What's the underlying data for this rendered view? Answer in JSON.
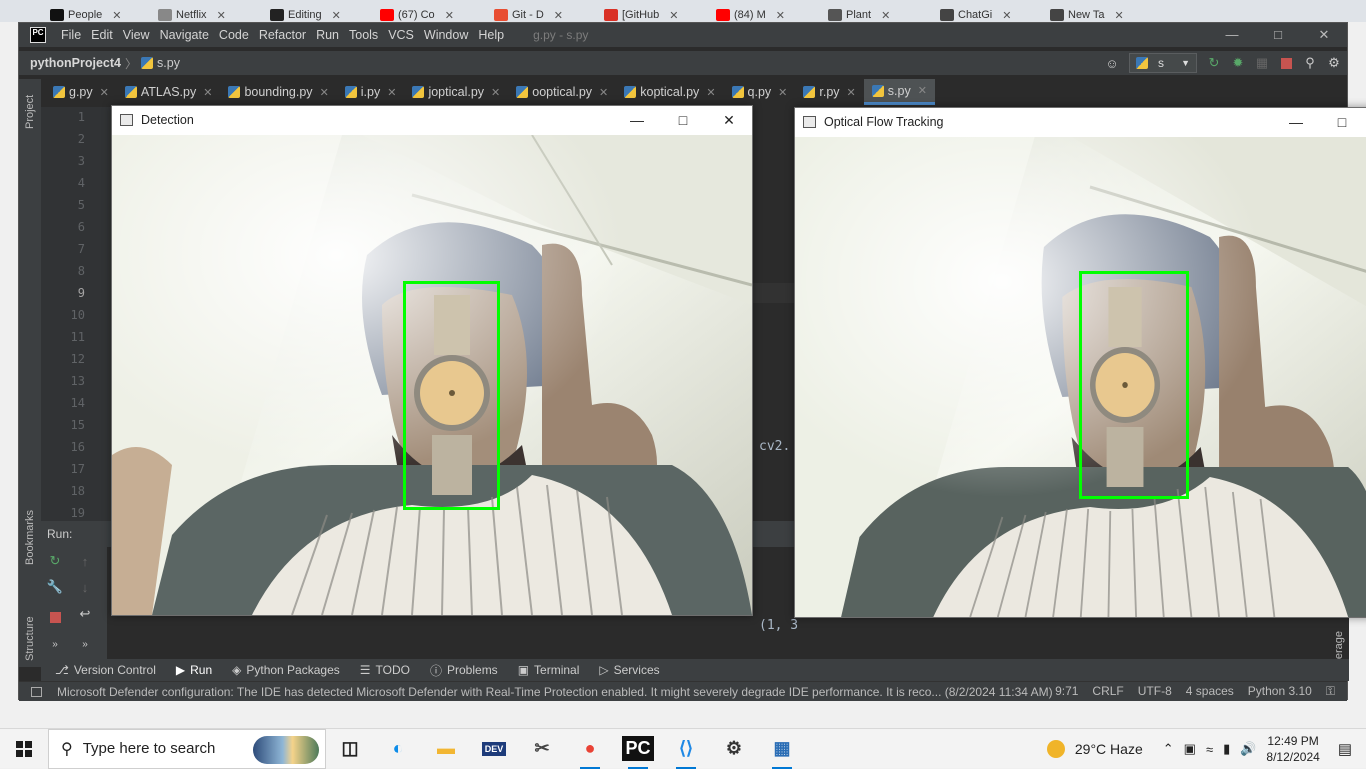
{
  "browser_tabs": [
    {
      "label": "People",
      "color": "#111111"
    },
    {
      "label": "Netflix",
      "color": "#888888"
    },
    {
      "label": "Editing",
      "color": "#222222"
    },
    {
      "label": "(67) Co",
      "color": "#ff0000"
    },
    {
      "label": "Git - D",
      "color": "#e84d31"
    },
    {
      "label": "[GitHub",
      "color": "#d93025"
    },
    {
      "label": "(84) M",
      "color": "#ff0000"
    },
    {
      "label": "Plant",
      "color": "#555555"
    },
    {
      "label": "ChatGi",
      "color": "#444444"
    },
    {
      "label": "New Ta",
      "color": "#444444"
    }
  ],
  "ide": {
    "logo": "PC",
    "menu": [
      "File",
      "Edit",
      "View",
      "Navigate",
      "Code",
      "Refactor",
      "Run",
      "Tools",
      "VCS",
      "Window",
      "Help"
    ],
    "window_title": "g.py - s.py",
    "project": "pythonProject4",
    "current_file": "s.py",
    "run_config": "s",
    "tabs": [
      {
        "label": "g.py",
        "active": false
      },
      {
        "label": "ATLAS.py",
        "active": false
      },
      {
        "label": "bounding.py",
        "active": false
      },
      {
        "label": "i.py",
        "active": false
      },
      {
        "label": "joptical.py",
        "active": false
      },
      {
        "label": "ooptical.py",
        "active": false
      },
      {
        "label": "koptical.py",
        "active": false
      },
      {
        "label": "q.py",
        "active": false
      },
      {
        "label": "r.py",
        "active": false
      },
      {
        "label": "s.py",
        "active": true
      }
    ],
    "line_numbers": [
      "1",
      "2",
      "3",
      "4",
      "5",
      "6",
      "7",
      "8",
      "9",
      "10",
      "11",
      "12",
      "13",
      "14",
      "15",
      "16",
      "17",
      "18",
      "19"
    ],
    "code_fragment": "cv2.",
    "console_fragment": "(1, 3",
    "side_labels": {
      "project": "Project",
      "bookmarks": "Bookmarks",
      "structure": "Structure",
      "right_edge": "erage"
    },
    "run_label": "Run:",
    "tool_windows": [
      {
        "label": "Version Control",
        "icon": "branch-icon"
      },
      {
        "label": "Run",
        "icon": "run-icon"
      },
      {
        "label": "Python Packages",
        "icon": "layers-icon"
      },
      {
        "label": "TODO",
        "icon": "list-icon"
      },
      {
        "label": "Problems",
        "icon": "info-icon"
      },
      {
        "label": "Terminal",
        "icon": "terminal-icon"
      },
      {
        "label": "Services",
        "icon": "services-icon"
      }
    ],
    "status_message": "Microsoft Defender configuration: The IDE has detected Microsoft Defender with Real-Time Protection enabled. It might severely degrade IDE performance. It is reco... (8/2/2024 11:34 AM)",
    "status_right": [
      "9:71",
      "CRLF",
      "UTF-8",
      "4 spaces",
      "Python 3.10"
    ]
  },
  "detection_window": {
    "title": "Detection"
  },
  "optical_window": {
    "title": "Optical Flow Tracking"
  },
  "taskbar": {
    "search_placeholder": "Type here to search",
    "weather": "29°C  Haze",
    "time": "12:49 PM",
    "date": "8/12/2024",
    "apps": [
      "task-view",
      "edge",
      "file-explorer",
      "dev-home",
      "snipping",
      "chrome",
      "pycharm",
      "vscode",
      "settings",
      "control-panel"
    ]
  }
}
